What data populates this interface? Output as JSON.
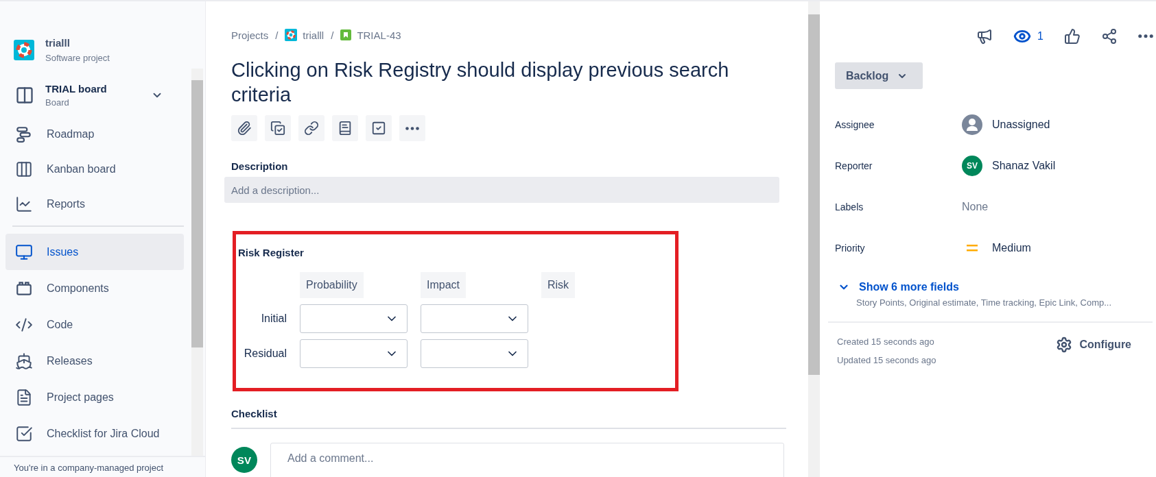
{
  "sidebar": {
    "project": {
      "name": "trialll",
      "type": "Software project"
    },
    "board": {
      "name": "TRIAL board",
      "subtitle": "Board"
    },
    "sections": [
      {
        "items": [
          {
            "label": "Roadmap",
            "kind": "roadmap",
            "selected": false
          },
          {
            "label": "Kanban board",
            "kind": "kanban",
            "selected": false
          },
          {
            "label": "Reports",
            "kind": "reports",
            "selected": false
          }
        ]
      },
      {
        "items": [
          {
            "label": "Issues",
            "kind": "issues",
            "selected": true
          },
          {
            "label": "Components",
            "kind": "components",
            "selected": false
          },
          {
            "label": "Code",
            "kind": "code",
            "selected": false
          },
          {
            "label": "Releases",
            "kind": "releases",
            "selected": false
          },
          {
            "label": "Project pages",
            "kind": "pages",
            "selected": false
          },
          {
            "label": "Checklist for Jira Cloud",
            "kind": "checklist",
            "selected": false
          }
        ]
      }
    ],
    "footer": "You're in a company-managed project"
  },
  "issue": {
    "breadcrumbs": [
      {
        "label": "Projects",
        "kind": "text"
      },
      {
        "label": "trialll",
        "kind": "project",
        "separator": "/"
      },
      {
        "label": "TRIAL-43",
        "kind": "issue",
        "separator": "/"
      }
    ],
    "title": "Clicking on Risk Registry should display previous search criteria",
    "toolbar": [
      {
        "kind": "attach"
      },
      {
        "kind": "subtask"
      },
      {
        "kind": "link"
      },
      {
        "kind": "page"
      },
      {
        "kind": "checklist"
      },
      {
        "kind": "more"
      }
    ],
    "description": {
      "label": "Description",
      "placeholder": "Add a description..."
    },
    "risk_register": {
      "title": "Risk Register",
      "columns": [
        "Probability",
        "Impact",
        "Risk"
      ],
      "rows": [
        {
          "label": "Initial",
          "cells": [
            {
              "kind": "select"
            },
            {
              "kind": "select"
            },
            {
              "kind": "empty"
            }
          ]
        },
        {
          "label": "Residual",
          "cells": [
            {
              "kind": "select"
            },
            {
              "kind": "select"
            },
            {
              "kind": "empty"
            }
          ]
        }
      ]
    },
    "checklist": {
      "title": "Checklist"
    },
    "comment": {
      "avatar": "SV",
      "placeholder": "Add a comment..."
    }
  },
  "details": {
    "actions": [
      {
        "kind": "feedback"
      },
      {
        "kind": "watch",
        "count": "1"
      },
      {
        "kind": "like"
      },
      {
        "kind": "share"
      },
      {
        "kind": "more"
      }
    ],
    "status": "Backlog",
    "fields": [
      {
        "label": "Assignee",
        "value": "Unassigned",
        "kind": "unassigned"
      },
      {
        "label": "Reporter",
        "value": "Shanaz Vakil",
        "kind": "user",
        "avatar": "SV"
      },
      {
        "label": "Labels",
        "value": "None",
        "kind": "empty"
      },
      {
        "label": "Priority",
        "value": "Medium",
        "kind": "priority"
      }
    ],
    "more_fields": {
      "label": "Show 6 more fields",
      "summary": "Story Points, Original estimate, Time tracking, Epic Link, Comp..."
    },
    "created": "Created 15 seconds ago",
    "updated": "Updated 15 seconds ago",
    "configure": "Configure"
  }
}
